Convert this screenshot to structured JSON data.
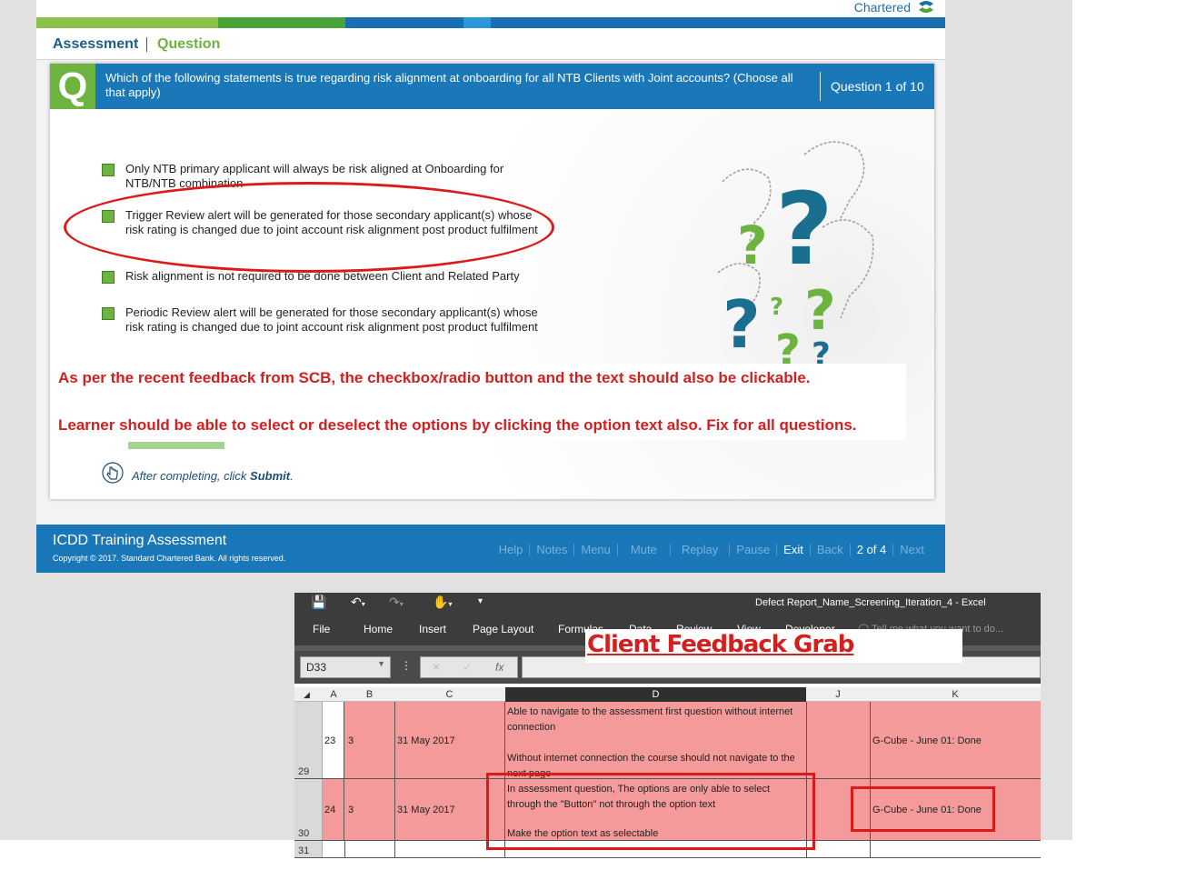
{
  "course": {
    "brand": "Chartered",
    "breadcrumb": {
      "section": "Assessment",
      "current": "Question"
    },
    "question": {
      "badge": "Q",
      "text": "Which of the following statements is true regarding risk alignment at onboarding for all NTB Clients with Joint accounts? (Choose all that apply)",
      "counter": "Question 1 of 10",
      "options": [
        "Only NTB primary applicant will always be risk aligned at Onboarding for NTB/NTB combination",
        "Trigger Review alert will be generated for those secondary applicant(s) whose risk rating is changed due to joint account risk alignment post product fulfilment",
        "Risk alignment is not required to be done between Client and Related Party",
        "Periodic Review alert will be generated for those secondary applicant(s) whose risk rating is changed due to joint account risk alignment post product fulfilment"
      ]
    },
    "feedback_note_1": "As per the recent feedback from SCB, the checkbox/radio button and the text should also be clickable.",
    "feedback_note_2": "Learner should be able to select or deselect the options by clicking the option text also. Fix for all questions.",
    "instruction_prefix": "After completing, click ",
    "instruction_action": "Submit",
    "instruction_suffix": ".",
    "footer": {
      "title": "ICDD Training Assessment",
      "copyright": "Copyright © 2017. Standard Chartered Bank. All rights reserved.",
      "nav": {
        "help": "Help",
        "notes": "Notes",
        "menu": "Menu",
        "mute": "Mute",
        "replay": "Replay",
        "pause": "Pause",
        "exit": "Exit",
        "back": "Back",
        "page": "2 of 4",
        "next": "Next"
      }
    },
    "colors": {
      "primary_blue": "#1a77b8",
      "accent_green": "#6db33f",
      "annotation_red": "#d21f1f"
    }
  },
  "excel": {
    "doc_title": "Defect Report_Name_Screening_Iteration_4 - Excel",
    "menu": [
      "File",
      "Home",
      "Insert",
      "Page Layout",
      "Formulas",
      "Data",
      "Review",
      "View",
      "Developer"
    ],
    "tell_me": "Tell me what you want to do...",
    "name_box": "D33",
    "caption": "Client Feedback Grab",
    "columns": [
      "A",
      "B",
      "C",
      "D",
      "J",
      "K"
    ],
    "rows": [
      {
        "row_num": "29",
        "a": "23",
        "b": "3",
        "c": "31 May 2017",
        "d_line1": "Able to navigate to the assessment first question without internet connection",
        "d_line2": "Without internet connection the course should not navigate to the next page",
        "k": "G-Cube - June 01: Done"
      },
      {
        "row_num": "30",
        "a": "24",
        "b": "3",
        "c": "31 May 2017",
        "d_line1": "In assessment question, The options are only able to select through the \"Button\" not through the option text",
        "d_line2": "Make the option text as selectable",
        "k": "G-Cube - June 01: Done"
      }
    ],
    "last_row_num": "31",
    "row_fill_color": "#f49a9a"
  }
}
